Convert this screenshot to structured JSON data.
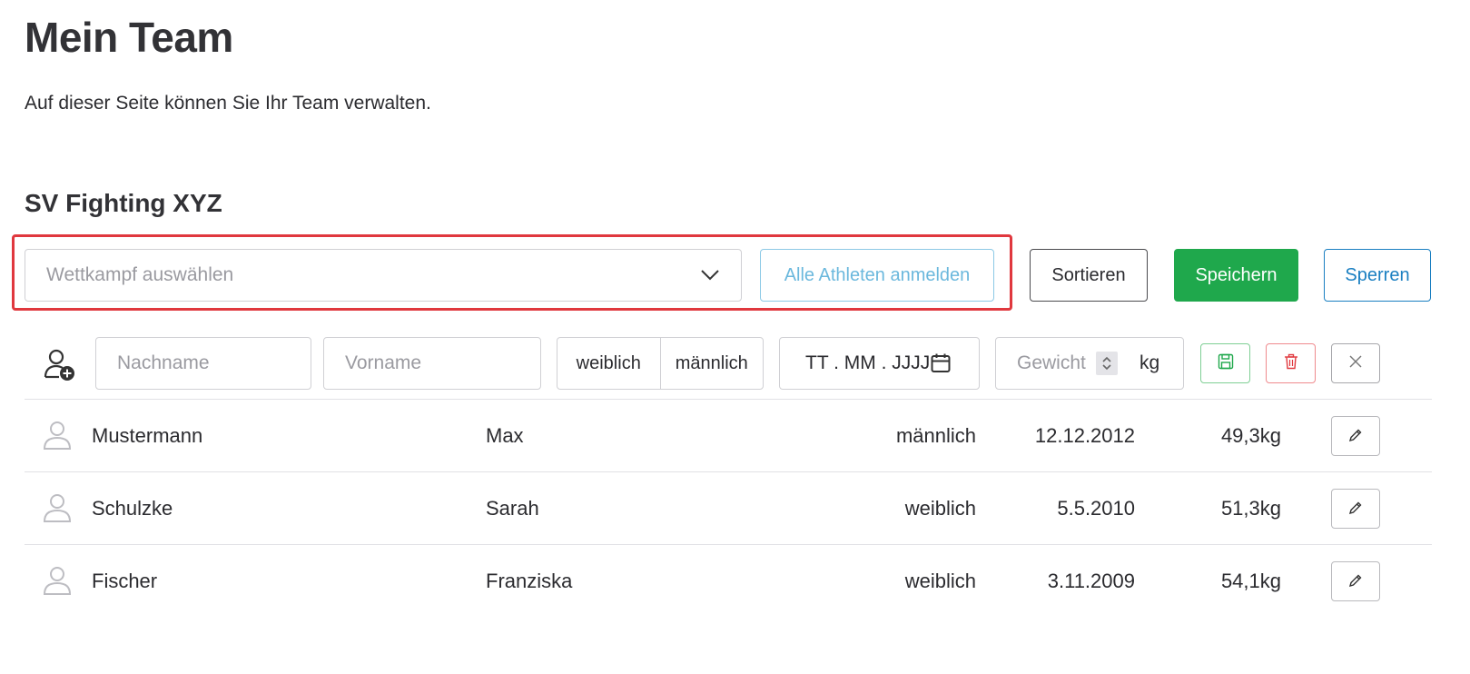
{
  "page": {
    "title": "Mein Team",
    "description": "Auf dieser Seite können Sie Ihr Team verwalten."
  },
  "team": {
    "name": "SV Fighting XYZ"
  },
  "toolbar": {
    "competition_placeholder": "Wettkampf auswählen",
    "register_all_label": "Alle Athleten anmelden",
    "sort_label": "Sortieren",
    "save_label": "Speichern",
    "lock_label": "Sperren"
  },
  "new_athlete": {
    "last_name_placeholder": "Nachname",
    "first_name_placeholder": "Vorname",
    "gender_options": [
      "weiblich",
      "männlich"
    ],
    "date_placeholder": "TT . MM . JJJJ",
    "weight_placeholder": "Gewicht",
    "weight_unit": "kg"
  },
  "athletes": [
    {
      "last_name": "Mustermann",
      "first_name": "Max",
      "gender": "männlich",
      "birthdate": "12.12.2012",
      "weight": "49,3kg"
    },
    {
      "last_name": "Schulzke",
      "first_name": "Sarah",
      "gender": "weiblich",
      "birthdate": "5.5.2010",
      "weight": "51,3kg"
    },
    {
      "last_name": "Fischer",
      "first_name": "Franziska",
      "gender": "weiblich",
      "birthdate": "3.11.2009",
      "weight": "54,1kg"
    }
  ],
  "colors": {
    "primary_green": "#1fa84c",
    "info_blue": "#1a7fc1",
    "light_blue": "#6bb8dd",
    "danger_red": "#e0383e",
    "highlight_border": "#e0383e"
  },
  "icons": {
    "add_user": "add-user-icon",
    "chevron": "chevron-down-icon",
    "calendar": "calendar-icon",
    "spinner": "spinner-icon",
    "save": "floppy-disk-icon",
    "delete": "trash-icon",
    "close": "close-icon",
    "avatar": "user-avatar-icon",
    "edit": "pencil-icon"
  }
}
